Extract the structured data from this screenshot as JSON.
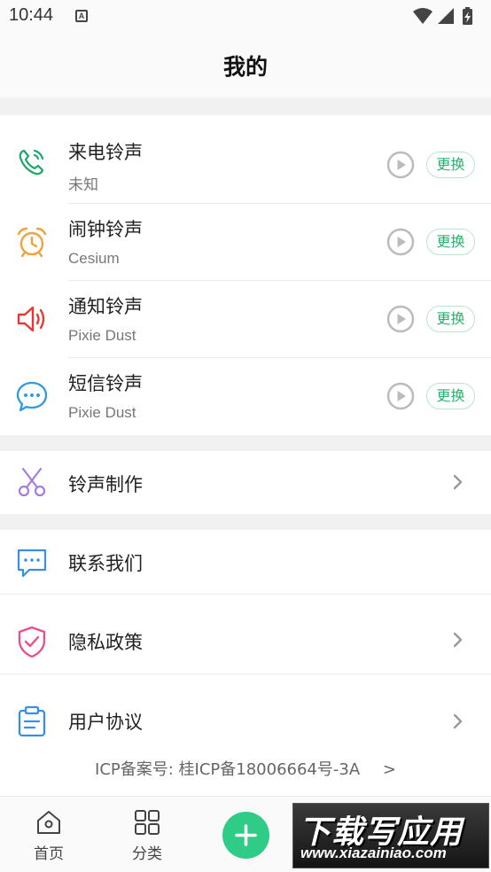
{
  "status_bar": {
    "time": "10:44",
    "notification_glyph": "A",
    "icons": [
      "wifi-icon",
      "signal-icon",
      "battery-charging-icon"
    ]
  },
  "header": {
    "title": "我的"
  },
  "ringtones": [
    {
      "title": "来电铃声",
      "value": "未知",
      "icon": "phone-ring-icon",
      "icon_color": "#1aa76b",
      "change_label": "更换"
    },
    {
      "title": "闹钟铃声",
      "value": "Cesium",
      "icon": "alarm-clock-icon",
      "icon_color": "#f2a23a",
      "change_label": "更换"
    },
    {
      "title": "通知铃声",
      "value": "Pixie Dust",
      "icon": "speaker-icon",
      "icon_color": "#e53935",
      "change_label": "更换"
    },
    {
      "title": "短信铃声",
      "value": "Pixie Dust",
      "icon": "chat-bubble-icon",
      "icon_color": "#2f9ae0",
      "change_label": "更换"
    }
  ],
  "maker": {
    "title": "铃声制作",
    "icon": "scissors-icon",
    "icon_color": "#a57ce0"
  },
  "menu": [
    {
      "title": "联系我们",
      "icon": "message-icon",
      "icon_color": "#3b8ee6",
      "chevron": false
    },
    {
      "title": "隐私政策",
      "icon": "shield-check-icon",
      "icon_color": "#ec4c8a",
      "chevron": true
    },
    {
      "title": "用户协议",
      "icon": "clipboard-icon",
      "icon_color": "#3b8ee6",
      "chevron": true
    }
  ],
  "icp": {
    "text": "ICP备案号: 桂ICP备18006664号-3A",
    "arrow": ">"
  },
  "bottom_nav": {
    "items": [
      {
        "label": "首页",
        "icon": "home-icon"
      },
      {
        "label": "分类",
        "icon": "grid-icon"
      }
    ],
    "fab_icon": "plus-icon",
    "fab_color": "#2ecc86"
  },
  "watermark": {
    "title": "下载写应用",
    "url": "www.xiazainiao.com"
  },
  "colors": {
    "accent": "#23b36f",
    "section_gap": "#f1f1f1"
  }
}
